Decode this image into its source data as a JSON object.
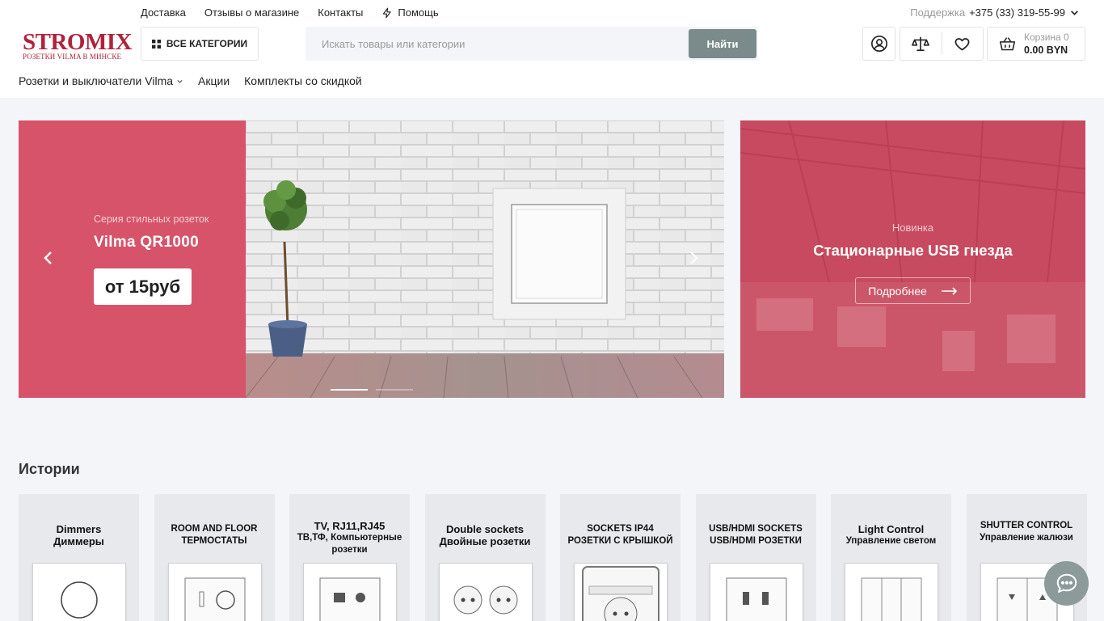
{
  "topnav": {
    "delivery": "Доставка",
    "reviews": "Отзывы о магазине",
    "contacts": "Контакты",
    "help": "Помощь"
  },
  "support": {
    "label": "Поддержка",
    "phone": "+375 (33) 319-55-99"
  },
  "logo": {
    "title": "STROMIX",
    "subtitle": "РОЗЕТКИ VILMA В МИНСКЕ"
  },
  "catalog_button": "ВСЕ КАТЕГОРИИ",
  "search": {
    "placeholder": "Искать товары или категории",
    "value": "",
    "button": "Найти"
  },
  "cart": {
    "label": "Корзина 0",
    "total": "0.00 BYN"
  },
  "mainnav": {
    "item1": "Розетки и выключатели Vilma",
    "item2": "Акции",
    "item3": "Комплекты со скидкой"
  },
  "slider": {
    "subtitle": "Серия стильных розеток",
    "title": "Vilma QR1000",
    "price": "от 15руб",
    "slide_count": 2,
    "active_slide": 1
  },
  "promo": {
    "subtitle": "Новинка",
    "title": "Стационарные USB гнезда",
    "button": "Подробнее"
  },
  "stories": {
    "title": "Истории",
    "items": [
      {
        "line1": "Dimmers",
        "line2": "Диммеры"
      },
      {
        "line1": "ROOM AND FLOOR",
        "line2": "ТЕРМОСТАТЫ"
      },
      {
        "line1": "TV, RJ11,RJ45",
        "line2": "ТВ,ТФ, Компьютерные розетки"
      },
      {
        "line1": "Double sockets",
        "line2": "Двойные розетки"
      },
      {
        "line1": "SOCKETS IP44",
        "line2": "РОЗЕТКИ С КРЫШКОЙ"
      },
      {
        "line1": "USB/HDMI SOCKETS",
        "line2": "USB/HDMI РОЗЕТКИ"
      },
      {
        "line1": "Light Control",
        "line2": "Управление светом"
      },
      {
        "line1": "SHUTTER CONTROL",
        "line2": "Управление жалюзи"
      }
    ]
  },
  "colors": {
    "brand": "#b0223a",
    "slide_pink": "#d65369",
    "search_button": "#7b8a8b"
  },
  "icons": {
    "help": "lightning-icon",
    "catalog": "grid-icon",
    "user": "user-circle-icon",
    "compare": "scales-icon",
    "favorites": "heart-icon",
    "cart": "basket-icon",
    "chat": "chat-bubble-icon"
  }
}
